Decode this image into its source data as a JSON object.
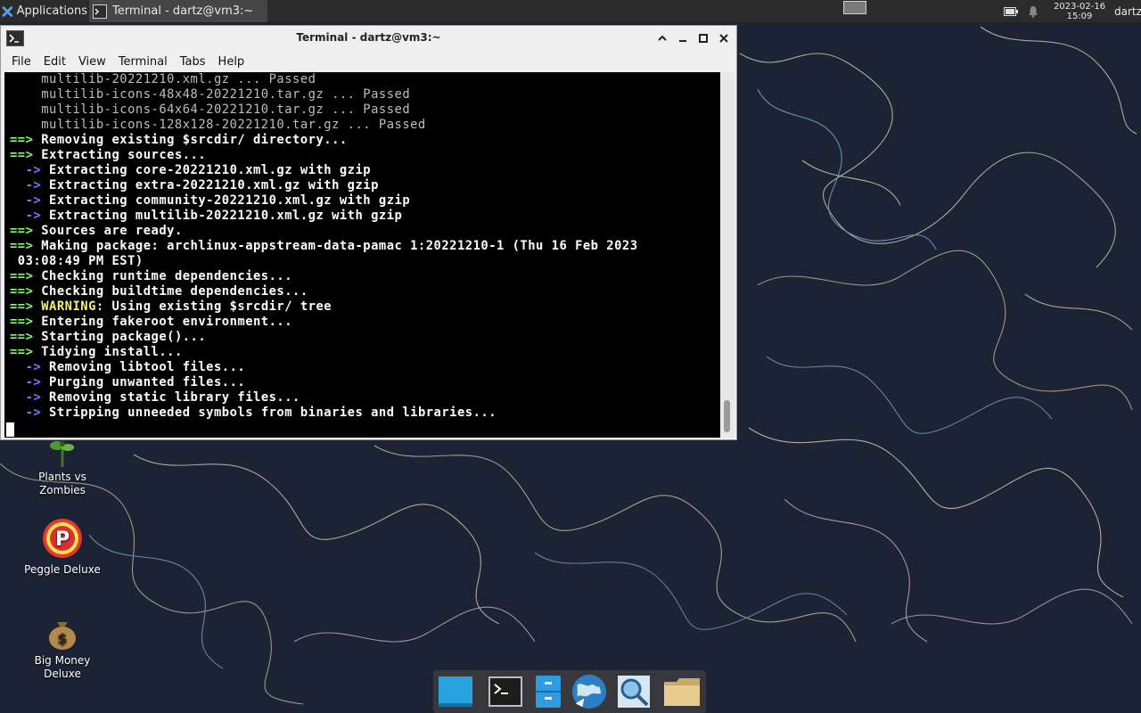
{
  "top_panel": {
    "applications_label": "Applications",
    "task_label": "Terminal - dartz@vm3:~",
    "clock_date": "2023-02-16",
    "clock_time": "15:09",
    "user_label": "dartz"
  },
  "window": {
    "title": "Terminal - dartz@vm3:~",
    "menu": [
      "File",
      "Edit",
      "View",
      "Terminal",
      "Tabs",
      "Help"
    ]
  },
  "terminal": {
    "lines": [
      {
        "prefix": "",
        "text": "    multilib-20221210.xml.gz ... Passed",
        "style": "dim"
      },
      {
        "prefix": "",
        "text": "    multilib-icons-48x48-20221210.tar.gz ... Passed",
        "style": "dim"
      },
      {
        "prefix": "",
        "text": "    multilib-icons-64x64-20221210.tar.gz ... Passed",
        "style": "dim"
      },
      {
        "prefix": "",
        "text": "    multilib-icons-128x128-20221210.tar.gz ... Passed",
        "style": "dim"
      },
      {
        "prefix": "==>",
        "text": " Removing existing $srcdir/ directory...",
        "style": "bold"
      },
      {
        "prefix": "==>",
        "text": " Extracting sources...",
        "style": "bold"
      },
      {
        "prefix": "  ->",
        "text": " Extracting core-20221210.xml.gz with gzip",
        "style": "bold"
      },
      {
        "prefix": "  ->",
        "text": " Extracting extra-20221210.xml.gz with gzip",
        "style": "bold"
      },
      {
        "prefix": "  ->",
        "text": " Extracting community-20221210.xml.gz with gzip",
        "style": "bold"
      },
      {
        "prefix": "  ->",
        "text": " Extracting multilib-20221210.xml.gz with gzip",
        "style": "bold"
      },
      {
        "prefix": "==>",
        "text": " Sources are ready.",
        "style": "bold"
      },
      {
        "prefix": "==>",
        "text": " Making package: archlinux-appstream-data-pamac 1:20221210-1 (Thu 16 Feb 2023",
        "style": "bold"
      },
      {
        "prefix": "",
        "text": " 03:08:49 PM EST)",
        "style": "bold"
      },
      {
        "prefix": "==>",
        "text": " Checking runtime dependencies...",
        "style": "bold"
      },
      {
        "prefix": "==>",
        "text": " Checking buildtime dependencies...",
        "style": "bold"
      },
      {
        "prefix": "==>",
        "text": " Using existing $srcdir/ tree",
        "style": "bold",
        "warn": " WARNING:"
      },
      {
        "prefix": "==>",
        "text": " Entering fakeroot environment...",
        "style": "bold"
      },
      {
        "prefix": "==>",
        "text": " Starting package()...",
        "style": "bold"
      },
      {
        "prefix": "==>",
        "text": " Tidying install...",
        "style": "bold"
      },
      {
        "prefix": "  ->",
        "text": " Removing libtool files...",
        "style": "bold"
      },
      {
        "prefix": "  ->",
        "text": " Purging unwanted files...",
        "style": "bold"
      },
      {
        "prefix": "  ->",
        "text": " Removing static library files...",
        "style": "bold"
      },
      {
        "prefix": "  ->",
        "text": " Stripping unneeded symbols from binaries and libraries...",
        "style": "bold"
      }
    ]
  },
  "desktop_icons": [
    {
      "name": "plants-vs-zombies",
      "label_line1": "Plants vs",
      "label_line2": "Zombies"
    },
    {
      "name": "peggle-deluxe",
      "label_line1": "Peggle Deluxe",
      "label_line2": ""
    },
    {
      "name": "big-money-deluxe",
      "label_line1": "Big Money",
      "label_line2": "Deluxe"
    }
  ],
  "dock": {
    "items": [
      "show-desktop-icon",
      "terminal-icon",
      "file-cabinet-icon",
      "web-browser-icon",
      "app-finder-icon",
      "folder-icon"
    ]
  },
  "colors": {
    "wallpaper": "#1a2233",
    "terminal_bg": "#000000",
    "prompt_green": "#7dff5f",
    "arrow_blue": "#6f7dff",
    "warning_yellow": "#f4f071"
  }
}
